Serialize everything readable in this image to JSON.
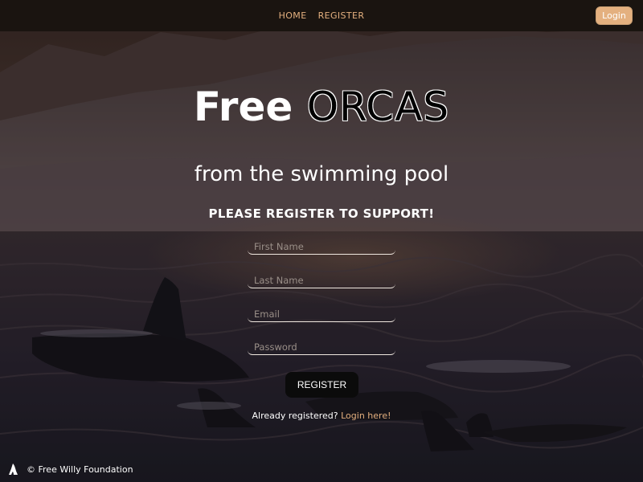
{
  "nav": {
    "links": [
      "HOME",
      "REGISTER"
    ],
    "login_label": "Login"
  },
  "hero": {
    "title_prefix": "Free",
    "title_highlight": "ORCAS",
    "subtitle": "from the swimming pool",
    "prompt": "PLEASE REGISTER TO SUPPORT!"
  },
  "form": {
    "first_name": {
      "placeholder": "First Name",
      "value": ""
    },
    "last_name": {
      "placeholder": "Last Name",
      "value": ""
    },
    "email": {
      "placeholder": "Email",
      "value": ""
    },
    "password": {
      "placeholder": "Password",
      "value": ""
    },
    "submit_label": "REGISTER",
    "already_text": "Already registered?",
    "login_link": "Login here!"
  },
  "footer": {
    "icon": "orca-fin-icon",
    "text": "© Free Willy Foundation"
  },
  "colors": {
    "accent": "#e4b07f",
    "navbar": "#1a1410",
    "button": "#0b0b0b"
  }
}
